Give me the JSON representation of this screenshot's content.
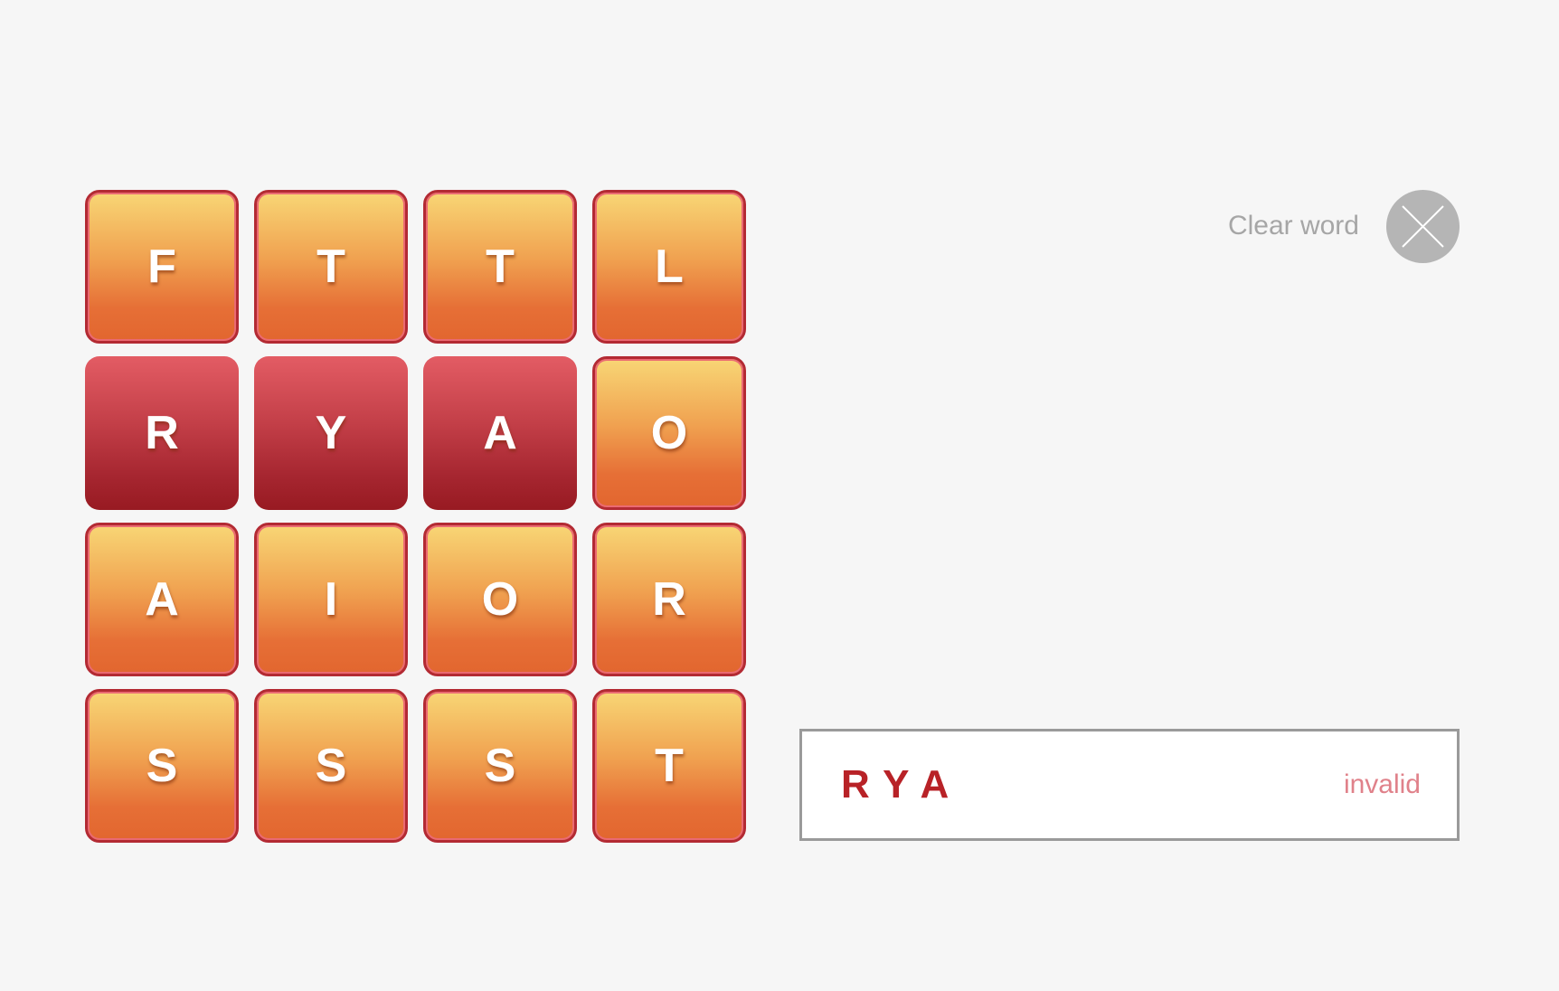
{
  "board": {
    "tiles": [
      {
        "letter": "F",
        "selected": false
      },
      {
        "letter": "T",
        "selected": false
      },
      {
        "letter": "T",
        "selected": false
      },
      {
        "letter": "L",
        "selected": false
      },
      {
        "letter": "R",
        "selected": true
      },
      {
        "letter": "Y",
        "selected": true
      },
      {
        "letter": "A",
        "selected": true
      },
      {
        "letter": "O",
        "selected": false
      },
      {
        "letter": "A",
        "selected": false
      },
      {
        "letter": "I",
        "selected": false
      },
      {
        "letter": "O",
        "selected": false
      },
      {
        "letter": "R",
        "selected": false
      },
      {
        "letter": "S",
        "selected": false
      },
      {
        "letter": "S",
        "selected": false
      },
      {
        "letter": "S",
        "selected": false
      },
      {
        "letter": "T",
        "selected": false
      }
    ]
  },
  "controls": {
    "clear_label": "Clear word",
    "clear_icon": "close-icon"
  },
  "word_panel": {
    "current_word": "RYA",
    "status": "invalid"
  },
  "colors": {
    "background": "#f6f6f6",
    "tile_top": "#f8d675",
    "tile_bottom": "#e2662f",
    "selected_top": "#e35c64",
    "selected_bottom": "#981a22",
    "word_text": "#b82227",
    "status_text": "#e0818a",
    "clear_button": "#b5b5b5"
  }
}
